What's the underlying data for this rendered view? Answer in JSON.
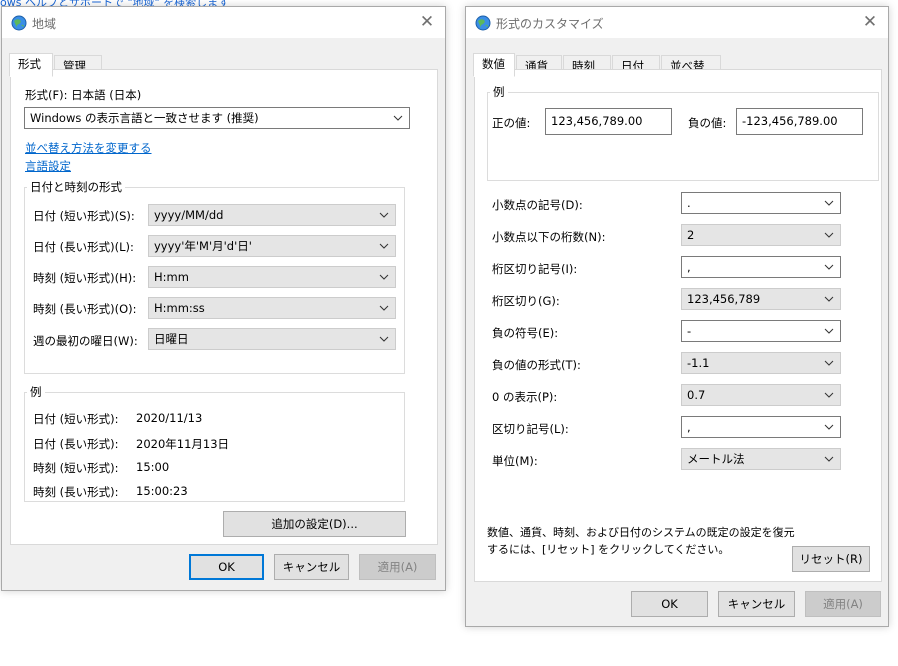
{
  "toplink": "ows ヘルプとサポートで \"地域\" を検索します",
  "left": {
    "title": "地域",
    "tabs": [
      "形式",
      "管理"
    ],
    "format_label": "形式(F): 日本語 (日本)",
    "format_combo": "Windows の表示言語と一致させます (推奨)",
    "link_sort": "並べ替え方法を変更する",
    "link_lang": "言語設定",
    "datetime_group": "日付と時刻の形式",
    "rows": [
      {
        "label": "日付 (短い形式)(S):",
        "value": "yyyy/MM/dd"
      },
      {
        "label": "日付 (長い形式)(L):",
        "value": "yyyy'年'M'月'd'日'"
      },
      {
        "label": "時刻 (短い形式)(H):",
        "value": "H:mm"
      },
      {
        "label": "時刻 (長い形式)(O):",
        "value": "H:mm:ss"
      },
      {
        "label": "週の最初の曜日(W):",
        "value": "日曜日"
      }
    ],
    "example_group": "例",
    "examples": [
      {
        "label": "日付 (短い形式):",
        "value": "2020/11/13"
      },
      {
        "label": "日付 (長い形式):",
        "value": "2020年11月13日"
      },
      {
        "label": "時刻 (短い形式):",
        "value": "15:00"
      },
      {
        "label": "時刻 (長い形式):",
        "value": "15:00:23"
      }
    ],
    "additional_button": "追加の設定(D)...",
    "ok": "OK",
    "cancel": "キャンセル",
    "apply": "適用(A)"
  },
  "right": {
    "title": "形式のカスタマイズ",
    "tabs": [
      "数値",
      "通貨",
      "時刻",
      "日付",
      "並べ替え"
    ],
    "example_group": "例",
    "positive_label": "正の値:",
    "positive_value": "123,456,789.00",
    "negative_label": "負の値:",
    "negative_value": "-123,456,789.00",
    "rows": [
      {
        "label": "小数点の記号(D):",
        "value": ".",
        "ro": false
      },
      {
        "label": "小数点以下の桁数(N):",
        "value": "2",
        "ro": true
      },
      {
        "label": "桁区切り記号(I):",
        "value": ",",
        "ro": false
      },
      {
        "label": "桁区切り(G):",
        "value": "123,456,789",
        "ro": true
      },
      {
        "label": "負の符号(E):",
        "value": "-",
        "ro": false
      },
      {
        "label": "負の値の形式(T):",
        "value": "-1.1",
        "ro": true
      },
      {
        "label": "0 の表示(P):",
        "value": "0.7",
        "ro": true
      },
      {
        "label": "区切り記号(L):",
        "value": ",",
        "ro": false
      },
      {
        "label": "単位(M):",
        "value": "メートル法",
        "ro": true
      }
    ],
    "reset_text_1": "数値、通貨、時刻、および日付のシステムの既定の設定を復元",
    "reset_text_2": "するには、[リセット] をクリックしてください。",
    "reset_button": "リセット(R)",
    "ok": "OK",
    "cancel": "キャンセル",
    "apply": "適用(A)"
  }
}
